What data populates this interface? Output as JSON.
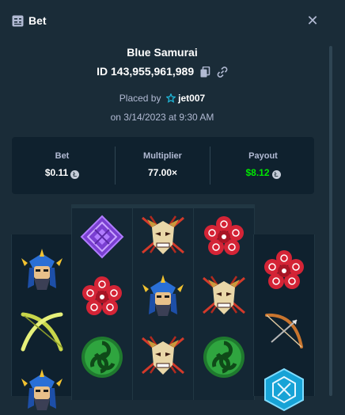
{
  "header": {
    "title": "Bet",
    "icon": "receipt-icon",
    "close_label": "✕"
  },
  "game": {
    "name": "Blue Samurai",
    "id_text": "ID 143,955,961,989",
    "placed_prefix": "Placed by",
    "user": "jet007",
    "date": "on 3/14/2023 at 9:30 AM"
  },
  "stats": {
    "bet": {
      "label": "Bet",
      "value": "$0.11"
    },
    "multiplier": {
      "label": "Multiplier",
      "value": "77.00×"
    },
    "payout": {
      "label": "Payout",
      "value": "$8.12"
    }
  },
  "reels": [
    [
      "samurai",
      "bow-staff",
      "samurai"
    ],
    [
      "purple-diamond",
      "red-flower",
      "green-swirl"
    ],
    [
      "mask",
      "samurai",
      "mask"
    ],
    [
      "red-flower",
      "mask",
      "green-swirl"
    ],
    [
      "red-flower",
      "bow",
      "blue-crest"
    ]
  ],
  "colors": {
    "background": "#1a2c38",
    "panel": "#0f212e",
    "muted_text": "#b1bad3",
    "payout_green": "#00e701"
  }
}
